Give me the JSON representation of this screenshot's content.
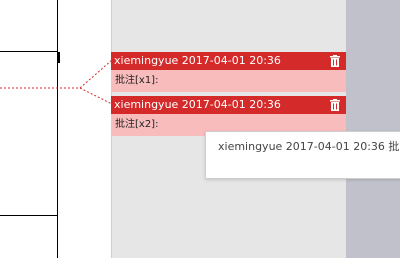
{
  "comments": [
    {
      "author_time": "xiemingyue 2017-04-01 20:36",
      "text": "批注[x1]:"
    },
    {
      "author_time": "xiemingyue 2017-04-01 20:36",
      "text": "批注[x2]:"
    }
  ],
  "tooltip": {
    "text": "xiemingyue 2017-04-01 20:36 批"
  },
  "colors": {
    "comment_header": "#d52a2a",
    "comment_body": "#f9bcbc",
    "pane": "#e6e6e6",
    "connector": "#d52a2a"
  }
}
